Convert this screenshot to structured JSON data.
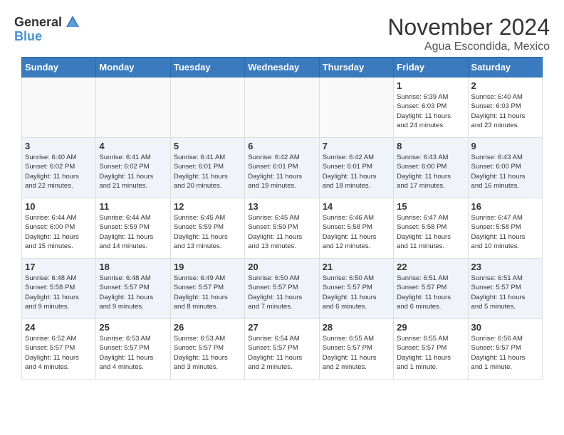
{
  "header": {
    "logo_general": "General",
    "logo_blue": "Blue",
    "month_title": "November 2024",
    "location": "Agua Escondida, Mexico"
  },
  "weekdays": [
    "Sunday",
    "Monday",
    "Tuesday",
    "Wednesday",
    "Thursday",
    "Friday",
    "Saturday"
  ],
  "weeks": [
    [
      {
        "day": "",
        "info": ""
      },
      {
        "day": "",
        "info": ""
      },
      {
        "day": "",
        "info": ""
      },
      {
        "day": "",
        "info": ""
      },
      {
        "day": "",
        "info": ""
      },
      {
        "day": "1",
        "info": "Sunrise: 6:39 AM\nSunset: 6:03 PM\nDaylight: 11 hours\nand 24 minutes."
      },
      {
        "day": "2",
        "info": "Sunrise: 6:40 AM\nSunset: 6:03 PM\nDaylight: 11 hours\nand 23 minutes."
      }
    ],
    [
      {
        "day": "3",
        "info": "Sunrise: 6:40 AM\nSunset: 6:02 PM\nDaylight: 11 hours\nand 22 minutes."
      },
      {
        "day": "4",
        "info": "Sunrise: 6:41 AM\nSunset: 6:02 PM\nDaylight: 11 hours\nand 21 minutes."
      },
      {
        "day": "5",
        "info": "Sunrise: 6:41 AM\nSunset: 6:01 PM\nDaylight: 11 hours\nand 20 minutes."
      },
      {
        "day": "6",
        "info": "Sunrise: 6:42 AM\nSunset: 6:01 PM\nDaylight: 11 hours\nand 19 minutes."
      },
      {
        "day": "7",
        "info": "Sunrise: 6:42 AM\nSunset: 6:01 PM\nDaylight: 11 hours\nand 18 minutes."
      },
      {
        "day": "8",
        "info": "Sunrise: 6:43 AM\nSunset: 6:00 PM\nDaylight: 11 hours\nand 17 minutes."
      },
      {
        "day": "9",
        "info": "Sunrise: 6:43 AM\nSunset: 6:00 PM\nDaylight: 11 hours\nand 16 minutes."
      }
    ],
    [
      {
        "day": "10",
        "info": "Sunrise: 6:44 AM\nSunset: 6:00 PM\nDaylight: 11 hours\nand 15 minutes."
      },
      {
        "day": "11",
        "info": "Sunrise: 6:44 AM\nSunset: 5:59 PM\nDaylight: 11 hours\nand 14 minutes."
      },
      {
        "day": "12",
        "info": "Sunrise: 6:45 AM\nSunset: 5:59 PM\nDaylight: 11 hours\nand 13 minutes."
      },
      {
        "day": "13",
        "info": "Sunrise: 6:45 AM\nSunset: 5:59 PM\nDaylight: 11 hours\nand 13 minutes."
      },
      {
        "day": "14",
        "info": "Sunrise: 6:46 AM\nSunset: 5:58 PM\nDaylight: 11 hours\nand 12 minutes."
      },
      {
        "day": "15",
        "info": "Sunrise: 6:47 AM\nSunset: 5:58 PM\nDaylight: 11 hours\nand 11 minutes."
      },
      {
        "day": "16",
        "info": "Sunrise: 6:47 AM\nSunset: 5:58 PM\nDaylight: 11 hours\nand 10 minutes."
      }
    ],
    [
      {
        "day": "17",
        "info": "Sunrise: 6:48 AM\nSunset: 5:58 PM\nDaylight: 11 hours\nand 9 minutes."
      },
      {
        "day": "18",
        "info": "Sunrise: 6:48 AM\nSunset: 5:57 PM\nDaylight: 11 hours\nand 9 minutes."
      },
      {
        "day": "19",
        "info": "Sunrise: 6:49 AM\nSunset: 5:57 PM\nDaylight: 11 hours\nand 8 minutes."
      },
      {
        "day": "20",
        "info": "Sunrise: 6:50 AM\nSunset: 5:57 PM\nDaylight: 11 hours\nand 7 minutes."
      },
      {
        "day": "21",
        "info": "Sunrise: 6:50 AM\nSunset: 5:57 PM\nDaylight: 11 hours\nand 6 minutes."
      },
      {
        "day": "22",
        "info": "Sunrise: 6:51 AM\nSunset: 5:57 PM\nDaylight: 11 hours\nand 6 minutes."
      },
      {
        "day": "23",
        "info": "Sunrise: 6:51 AM\nSunset: 5:57 PM\nDaylight: 11 hours\nand 5 minutes."
      }
    ],
    [
      {
        "day": "24",
        "info": "Sunrise: 6:52 AM\nSunset: 5:57 PM\nDaylight: 11 hours\nand 4 minutes."
      },
      {
        "day": "25",
        "info": "Sunrise: 6:53 AM\nSunset: 5:57 PM\nDaylight: 11 hours\nand 4 minutes."
      },
      {
        "day": "26",
        "info": "Sunrise: 6:53 AM\nSunset: 5:57 PM\nDaylight: 11 hours\nand 3 minutes."
      },
      {
        "day": "27",
        "info": "Sunrise: 6:54 AM\nSunset: 5:57 PM\nDaylight: 11 hours\nand 2 minutes."
      },
      {
        "day": "28",
        "info": "Sunrise: 6:55 AM\nSunset: 5:57 PM\nDaylight: 11 hours\nand 2 minutes."
      },
      {
        "day": "29",
        "info": "Sunrise: 6:55 AM\nSunset: 5:57 PM\nDaylight: 11 hours\nand 1 minute."
      },
      {
        "day": "30",
        "info": "Sunrise: 6:56 AM\nSunset: 5:57 PM\nDaylight: 11 hours\nand 1 minute."
      }
    ]
  ]
}
